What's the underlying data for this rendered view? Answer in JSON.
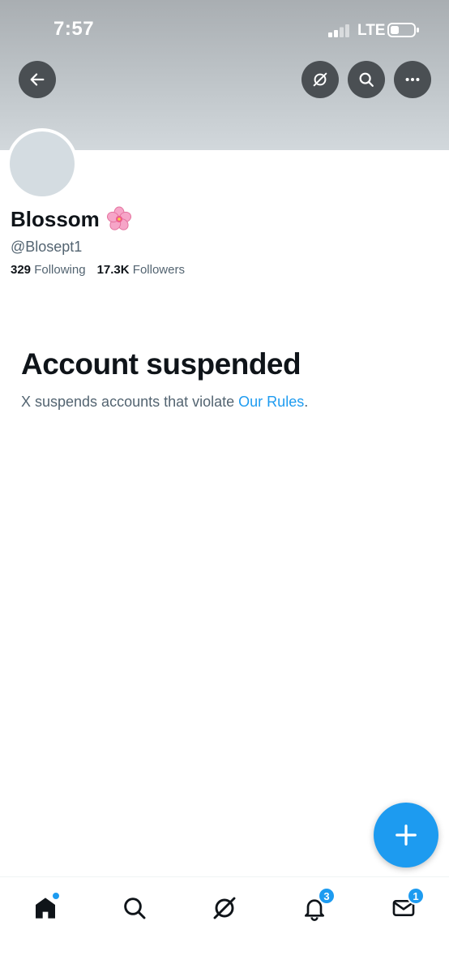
{
  "status_bar": {
    "time": "7:57",
    "network": "LTE"
  },
  "profile": {
    "display_name": "Blossom",
    "handle": "@Blosept1",
    "following_count": "329",
    "following_label": "Following",
    "followers_count": "17.3K",
    "followers_label": "Followers"
  },
  "suspension": {
    "title": "Account suspended",
    "message": "X suspends accounts that violate ",
    "link_text": "Our Rules",
    "message_end": "."
  },
  "bottom_nav": {
    "items": [
      {
        "icon": "home-icon"
      },
      {
        "icon": "search-icon"
      },
      {
        "icon": "grok-icon"
      },
      {
        "icon": "notifications-icon",
        "badge": "3"
      },
      {
        "icon": "messages-icon",
        "badge": "1"
      }
    ]
  },
  "colors": {
    "accent": "#1d9bf0",
    "text_primary": "#0f1419",
    "text_secondary": "#536471"
  }
}
